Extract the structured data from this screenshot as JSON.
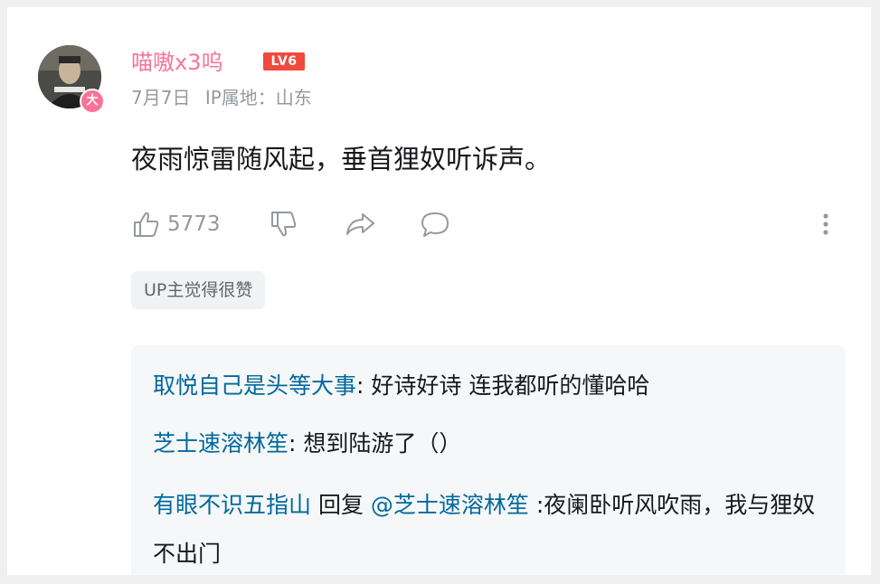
{
  "comment": {
    "username": "喵嗷x3呜",
    "level": "LV6",
    "avatar_badge": "大",
    "date": "7月7日",
    "ip_location": "IP属地：山东",
    "text": "夜雨惊雷随风起，垂首狸奴听诉声。",
    "like_count": "5773",
    "up_tag": "UP主觉得很赞"
  },
  "replies": [
    {
      "user": "取悦自己是头等大事",
      "text": ": 好诗好诗 连我都听的懂哈哈"
    },
    {
      "user": "芝士速溶林笙",
      "text": ": 想到陆游了（）"
    },
    {
      "user": "有眼不识五指山",
      "reply_word": " 回复 ",
      "mention": "@芝士速溶林笙",
      "text": " :夜阑卧听风吹雨，我与狸奴不出门"
    }
  ],
  "colors": {
    "username": "#fb7299",
    "reply_user": "#00699d",
    "level_badge": "#f04a3c",
    "meta": "#9499a0"
  },
  "icons": [
    "like-icon",
    "dislike-icon",
    "share-icon",
    "reply-icon",
    "more-icon"
  ]
}
